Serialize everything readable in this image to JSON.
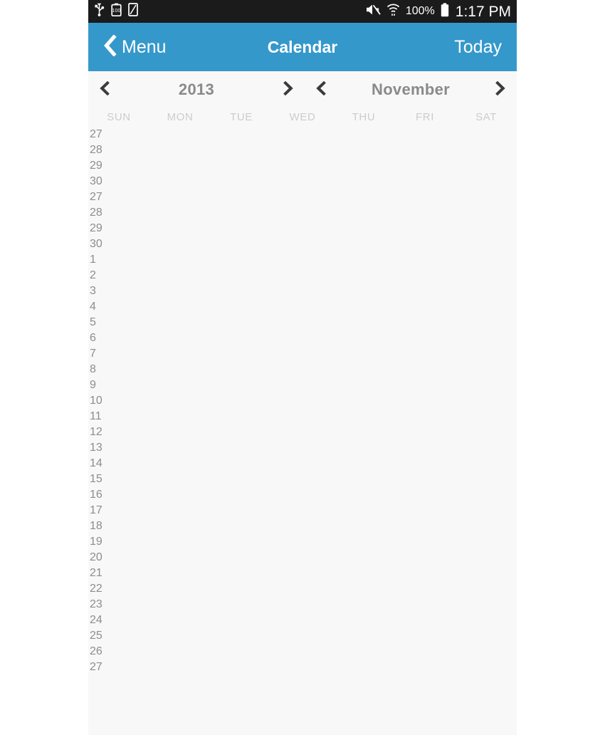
{
  "statusbar": {
    "icons_left": [
      "usb-icon",
      "battery-full-icon",
      "sd-card-icon"
    ],
    "icons_right": [
      "mute-icon",
      "wifi-icon"
    ],
    "battery_percent": "100%",
    "battery_icon": "battery-icon",
    "clock": "1:17 PM"
  },
  "navbar": {
    "back_icon": "chevron-left-icon",
    "back_label": "Menu",
    "title": "Calendar",
    "today_label": "Today",
    "background_color": "#3598cb"
  },
  "periodnav": {
    "year": {
      "prev_icon": "chevron-left-icon",
      "value": "2013",
      "next_icon": "chevron-right-icon"
    },
    "month": {
      "prev_icon": "chevron-left-icon",
      "value": "November",
      "next_icon": "chevron-right-icon"
    }
  },
  "weekdays": [
    "SUN",
    "MON",
    "TUE",
    "WED",
    "THU",
    "FRI",
    "SAT"
  ],
  "days": [
    "27",
    "28",
    "29",
    "30",
    "27",
    "28",
    "29",
    "30",
    "1",
    "2",
    "3",
    "4",
    "5",
    "6",
    "7",
    "8",
    "9",
    "10",
    "11",
    "12",
    "13",
    "14",
    "15",
    "16",
    "17",
    "18",
    "19",
    "20",
    "21",
    "22",
    "23",
    "24",
    "25",
    "26",
    "27"
  ],
  "colors": {
    "accent": "#3598cb",
    "content_bg": "#f8f8f8",
    "statusbar_bg": "#1b1b1b",
    "day_text": "#8d8d8d",
    "weekday_text": "#cccccc",
    "period_text": "#8a8a8a"
  }
}
